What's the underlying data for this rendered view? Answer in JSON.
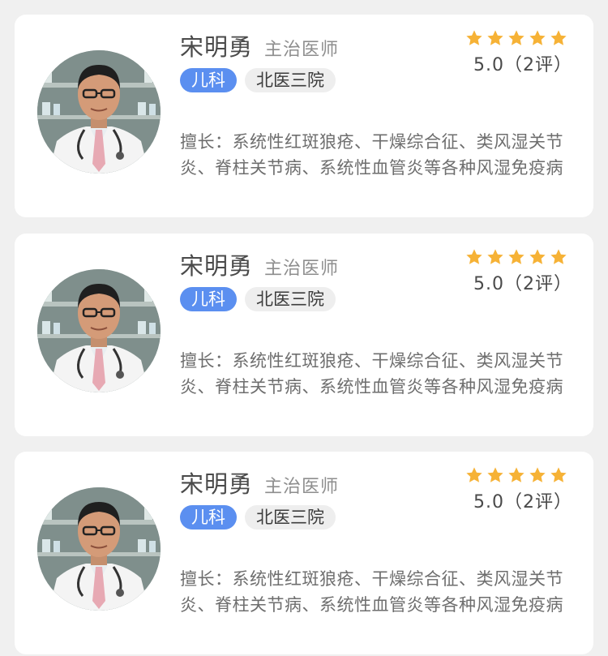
{
  "doctors": [
    {
      "name": "宋明勇",
      "title": "主治医师",
      "department": "儿科",
      "hospital": "北医三院",
      "rating": "5.0（2评）",
      "stars": 5,
      "specialty": "擅长：系统性红斑狼疮、干燥综合征、类风湿关节炎、脊柱关节病、系统性血管炎等各种风湿免疫病"
    },
    {
      "name": "宋明勇",
      "title": "主治医师",
      "department": "儿科",
      "hospital": "北医三院",
      "rating": "5.0（2评）",
      "stars": 5,
      "specialty": "擅长：系统性红斑狼疮、干燥综合征、类风湿关节炎、脊柱关节病、系统性血管炎等各种风湿免疫病"
    },
    {
      "name": "宋明勇",
      "title": "主治医师",
      "department": "儿科",
      "hospital": "北医三院",
      "rating": "5.0（2评）",
      "stars": 5,
      "specialty": "擅长：系统性红斑狼疮、干燥综合征、类风湿关节炎、脊柱关节病、系统性血管炎等各种风湿免疫病"
    }
  ],
  "colors": {
    "star": "#f6b236",
    "department_tag": "#5b8ff0",
    "hospital_tag": "#eeeeee",
    "page_background": "#f0f0f0"
  },
  "icons": {
    "star": "star-icon",
    "avatar": "doctor-avatar"
  }
}
